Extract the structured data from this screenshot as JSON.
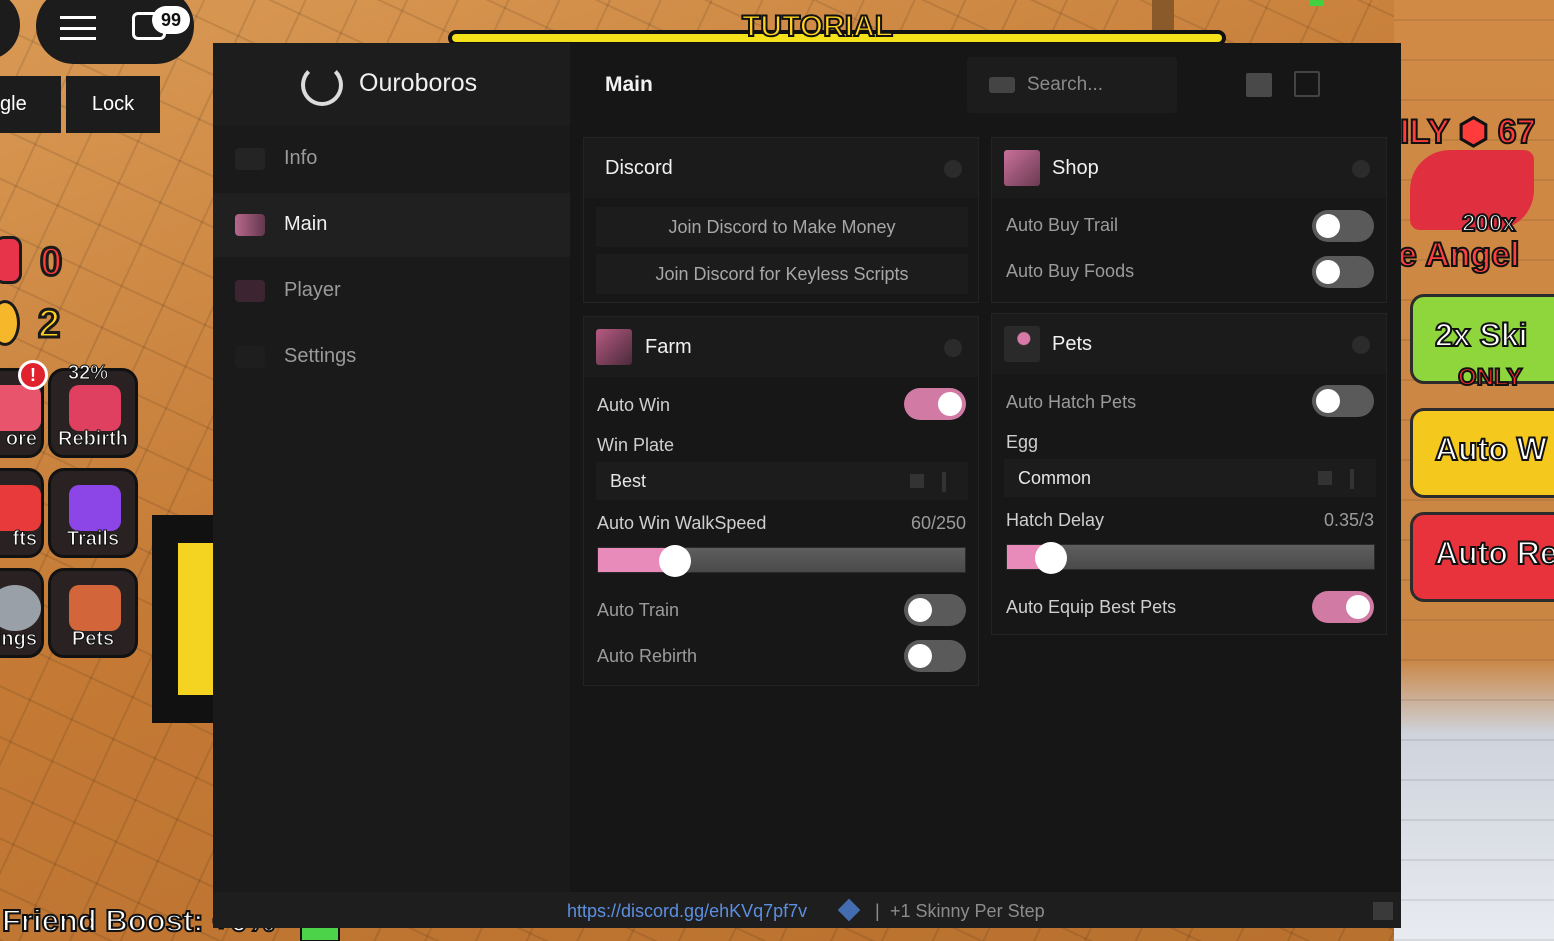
{
  "game": {
    "tutorial_label": "TUTORIAL",
    "chat_badge": "99",
    "hud_buttons": {
      "toggle": "gle",
      "lock": "Lock"
    },
    "stats": {
      "gems": "0",
      "coins": "2"
    },
    "alert": "!",
    "rebirth_percent": "32%",
    "tiles": {
      "store": "ore",
      "rebirth": "Rebirth",
      "gifts": "fts",
      "trails": "Trails",
      "settings": "ings",
      "pets": "Pets"
    },
    "friend_boost": "Friend Boost: +0%",
    "promo": {
      "only": "ILY",
      "price": "67",
      "multiplier": "200x",
      "angel": "e Angel"
    },
    "side_tiles": {
      "skin": "2x Ski",
      "skin_sub": "ONLY",
      "auto_w": "Auto W",
      "auto_re": "Auto Re"
    }
  },
  "window": {
    "brand": "Ouroboros",
    "nav": [
      {
        "label": "Info",
        "icon": "info-icon",
        "active": false
      },
      {
        "label": "Main",
        "icon": "main-icon",
        "active": true
      },
      {
        "label": "Player",
        "icon": "player-icon",
        "active": false
      },
      {
        "label": "Settings",
        "icon": "settings-icon",
        "active": false
      }
    ],
    "page_title": "Main",
    "search_placeholder": "Search...",
    "accent_color": "#e88aba",
    "panels": {
      "discord": {
        "title": "Discord",
        "buttons": [
          "Join Discord to Make Money",
          "Join Discord for Keyless Scripts"
        ]
      },
      "shop": {
        "title": "Shop",
        "toggles": [
          {
            "label": "Auto Buy Trail",
            "on": false
          },
          {
            "label": "Auto Buy Foods",
            "on": false
          }
        ]
      },
      "farm": {
        "title": "Farm",
        "auto_win": {
          "label": "Auto Win",
          "on": true
        },
        "win_plate": {
          "label": "Win Plate",
          "value": "Best"
        },
        "walkspeed": {
          "label": "Auto Win WalkSpeed",
          "value_text": "60/250",
          "value": 60,
          "max": 250,
          "fill_fraction": 0.21
        },
        "auto_train": {
          "label": "Auto Train",
          "on": false
        },
        "auto_rebirth": {
          "label": "Auto Rebirth",
          "on": false
        }
      },
      "pets": {
        "title": "Pets",
        "auto_hatch": {
          "label": "Auto Hatch Pets",
          "on": false
        },
        "egg": {
          "label": "Egg",
          "value": "Common"
        },
        "hatch_delay": {
          "label": "Hatch Delay",
          "value_text": "0.35/3",
          "value": 0.35,
          "max": 3,
          "fill_fraction": 0.12
        },
        "auto_equip": {
          "label": "Auto Equip Best Pets",
          "on": true
        }
      }
    },
    "footer": {
      "link": "https://discord.gg/ehKVq7pf7v",
      "separator": "|",
      "status": "+1 Skinny Per Step"
    }
  }
}
